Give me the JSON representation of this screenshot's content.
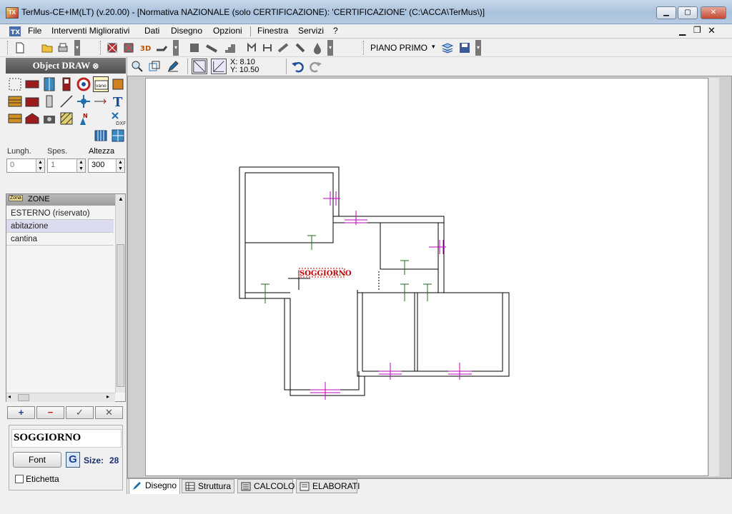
{
  "window": {
    "title": "TerMus-CE+IM(LT) (v.20.00) - [Normativa NAZIONALE (solo CERTIFICAZIONE): 'CERTIFICAZIONE'   (C:\\ACCA\\TerMus\\)]",
    "app_icon_text": "TX"
  },
  "menu": {
    "items": [
      "File",
      "Interventi Migliorativi",
      "Dati",
      "Disegno",
      "Opzioni",
      "Finestra",
      "Servizi",
      "?"
    ]
  },
  "toolbar": {
    "floor_selector": "PIANO PRIMO"
  },
  "draw_panel": {
    "header": "Object DRAW",
    "length_label": "Lungh.",
    "length_value": "0",
    "thickness_label": "Spes.",
    "thickness_value": "1",
    "height_label": "Altezza",
    "height_value": "300"
  },
  "coords": {
    "x": "X: 8.10",
    "y": "Y: 10.50"
  },
  "zones": {
    "header": "ZONE",
    "header_icon_text": "Zona",
    "items": [
      "ESTERNO (riservato)",
      "abitazione",
      "cantina"
    ],
    "selected": "abitazione"
  },
  "zone_buttons": [
    "+",
    "−",
    "✓",
    "✕"
  ],
  "label_panel": {
    "name": "SOGGIORNO",
    "font_button": "Font",
    "g_button": "G",
    "size_label": "Size:",
    "size_value": "28",
    "checkbox_label": "Etichetta"
  },
  "canvas": {
    "room_label": "SOGGIORNO"
  },
  "tabs": [
    "Disegno",
    "Struttura",
    "CALCOLO",
    "ELABORATI"
  ],
  "colors": {
    "wall": "#000000",
    "window_marker": "#c000c0",
    "door_marker": "#1f6b1f",
    "label": "#c00000"
  }
}
